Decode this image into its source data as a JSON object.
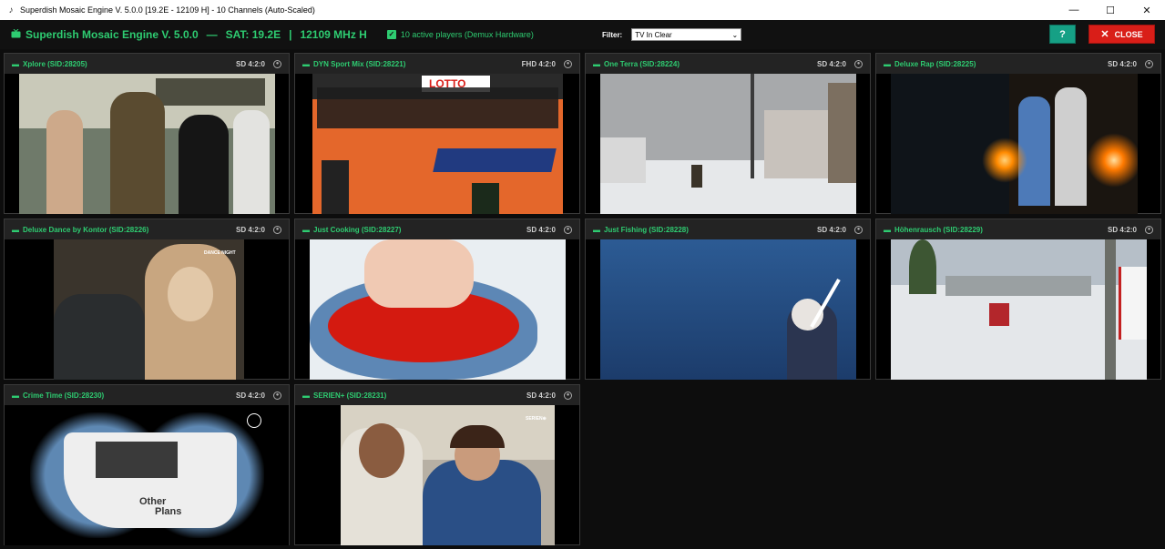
{
  "window": {
    "title": "Superdish Mosaic Engine V. 5.0.0 [19.2E - 12109 H] - 10 Channels (Auto-Scaled)",
    "minimize_glyph": "—",
    "maximize_glyph": "☐",
    "close_glyph": "✕"
  },
  "header": {
    "app_name": "Superdish Mosaic Engine V. 5.0.0",
    "separator1": "—",
    "sat": "SAT: 19.2E",
    "separator2": "|",
    "freq": "12109 MHz H",
    "players": "10 active players (Demux Hardware)",
    "filter_label": "Filter:",
    "filter_value": "TV In Clear",
    "help_label": "?",
    "close_label": "CLOSE"
  },
  "colors": {
    "accent": "#2ecc71",
    "close_button": "#d91e18",
    "help_button": "#16a085",
    "background": "#0d0d0d",
    "tile_header": "#232323"
  },
  "icons": {
    "tv": "tv-icon",
    "checkbox": "checkbox-checked-icon",
    "record": "record-icon",
    "dropdown": "chevron-down-icon"
  },
  "channels": [
    {
      "name": "Xplore (SID:28205)",
      "format": "SD 4:2:0"
    },
    {
      "name": "DYN Sport Mix (SID:28221)",
      "format": "FHD 4:2:0"
    },
    {
      "name": "One Terra (SID:28224)",
      "format": "SD 4:2:0"
    },
    {
      "name": "Deluxe Rap (SID:28225)",
      "format": "SD 4:2:0"
    },
    {
      "name": "Deluxe Dance by Kontor (SID:28226)",
      "format": "SD 4:2:0"
    },
    {
      "name": "Just Cooking (SID:28227)",
      "format": "SD 4:2:0"
    },
    {
      "name": "Just Fishing (SID:28228)",
      "format": "SD 4:2:0"
    },
    {
      "name": "Höhenrausch (SID:28229)",
      "format": "SD 4:2:0"
    },
    {
      "name": "Crime Time (SID:28230)",
      "format": "SD 4:2:0"
    },
    {
      "name": "SERIEN+ (SID:28231)",
      "format": "SD 4:2:0"
    }
  ],
  "overlays": {
    "lotto": "LOTTO",
    "dance_night": "DANCE NIGHT",
    "serien": "SERIEN⊕",
    "boat_line1": "Other",
    "boat_line2": "Plans"
  }
}
